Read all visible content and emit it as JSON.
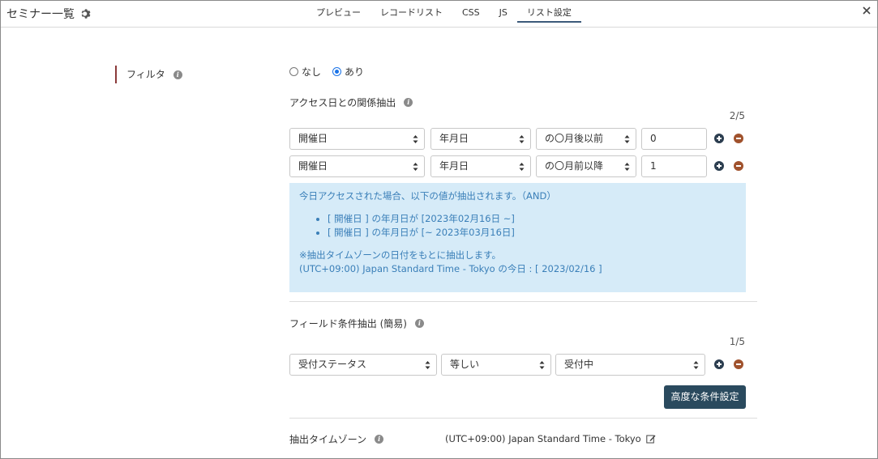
{
  "app": {
    "title": "セミナー一覧",
    "tabs": [
      {
        "label": "プレビュー",
        "active": false
      },
      {
        "label": "レコードリスト",
        "active": false
      },
      {
        "label": "CSS",
        "active": false
      },
      {
        "label": "JS",
        "active": false
      },
      {
        "label": "リスト設定",
        "active": true
      }
    ]
  },
  "filter": {
    "label": "フィルタ",
    "options": [
      {
        "label": "なし",
        "checked": false
      },
      {
        "label": "あり",
        "checked": true
      }
    ]
  },
  "access_date": {
    "heading": "アクセス日との関係抽出",
    "counter": "2/5",
    "rows": [
      {
        "field": "開催日",
        "unit": "年月日",
        "relation": "の〇月後以前",
        "value": "0"
      },
      {
        "field": "開催日",
        "unit": "年月日",
        "relation": "の〇月前以降",
        "value": "1"
      }
    ],
    "info": {
      "intro": "今日アクセスされた場合、以下の値が抽出されます。（AND）",
      "items": [
        "[ 開催日 ] の年月日が [2023年02月16日 ~]",
        "[ 開催日 ] の年月日が [~ 2023年03月16日]"
      ],
      "note1": "※抽出タイムゾーンの日付をもとに抽出します。",
      "note2": "(UTC+09:00) Japan Standard Time - Tokyo の今日 : [ 2023/02/16 ]"
    }
  },
  "field_cond": {
    "heading": "フィールド条件抽出 (簡易)",
    "counter": "1/5",
    "row": {
      "field": "受付ステータス",
      "op": "等しい",
      "value": "受付中"
    },
    "advanced_button": "高度な条件設定"
  },
  "timezone": {
    "label": "抽出タイムゾーン",
    "value": "(UTC+09:00) Japan Standard Time - Tokyo"
  },
  "colors": {
    "accent": "#2a4a5e",
    "info_bg": "#d6ebf8",
    "info_text": "#3a7fb8",
    "add": "#2c3e50",
    "remove": "#a0522d"
  }
}
